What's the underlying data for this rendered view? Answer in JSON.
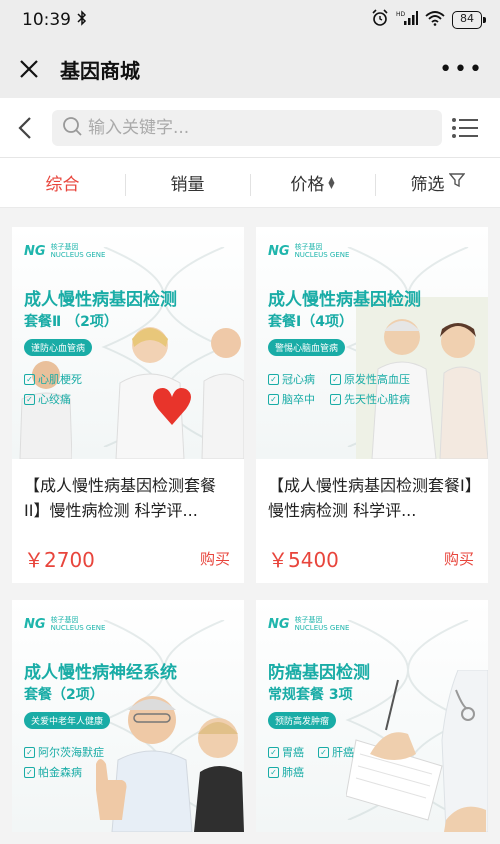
{
  "status": {
    "time": "10:39",
    "battery": "84"
  },
  "titlebar": {
    "title": "基因商城"
  },
  "search": {
    "placeholder": "输入关键字..."
  },
  "sort_tabs": [
    {
      "label": "综合"
    },
    {
      "label": "销量"
    },
    {
      "label": "价格"
    },
    {
      "label": "筛选"
    }
  ],
  "products": [
    {
      "logo": "核子基因",
      "logo_sub": "NUCLEUS GENE",
      "img_title": "成人慢性病基因检测",
      "img_subtitle": "套餐Ⅱ （2项）",
      "img_pill": "谨防心血管病",
      "img_checks": [
        "心肌梗死",
        "心绞痛"
      ],
      "name": "【成人慢性病基因检测套餐II】慢性病检测 科学评...",
      "price": "￥2700",
      "buy_label": "购买"
    },
    {
      "logo": "核子基因",
      "logo_sub": "NUCLEUS GENE",
      "img_title": "成人慢性病基因检测",
      "img_subtitle": "套餐Ⅰ（4项）",
      "img_pill": "警惕心脑血管病",
      "img_checks": [
        "冠心病",
        "原发性高血压",
        "脑卒中",
        "先天性心脏病"
      ],
      "name": "【成人慢性病基因检测套餐I】慢性病检测 科学评...",
      "price": "￥5400",
      "buy_label": "购买"
    },
    {
      "logo": "核子基因",
      "logo_sub": "NUCLEUS GENE",
      "img_title": "成人慢性病神经系统",
      "img_subtitle": "套餐（2项）",
      "img_pill": "关爱中老年人健康",
      "img_checks": [
        "阿尔茨海默症",
        "帕金森病"
      ]
    },
    {
      "logo": "核子基因",
      "logo_sub": "NUCLEUS GENE",
      "img_title": "防癌基因检测",
      "img_subtitle": "常规套餐 3项",
      "img_pill": "预防高发肿瘤",
      "img_checks": [
        "胃癌",
        "肝癌",
        "肺癌"
      ]
    }
  ]
}
